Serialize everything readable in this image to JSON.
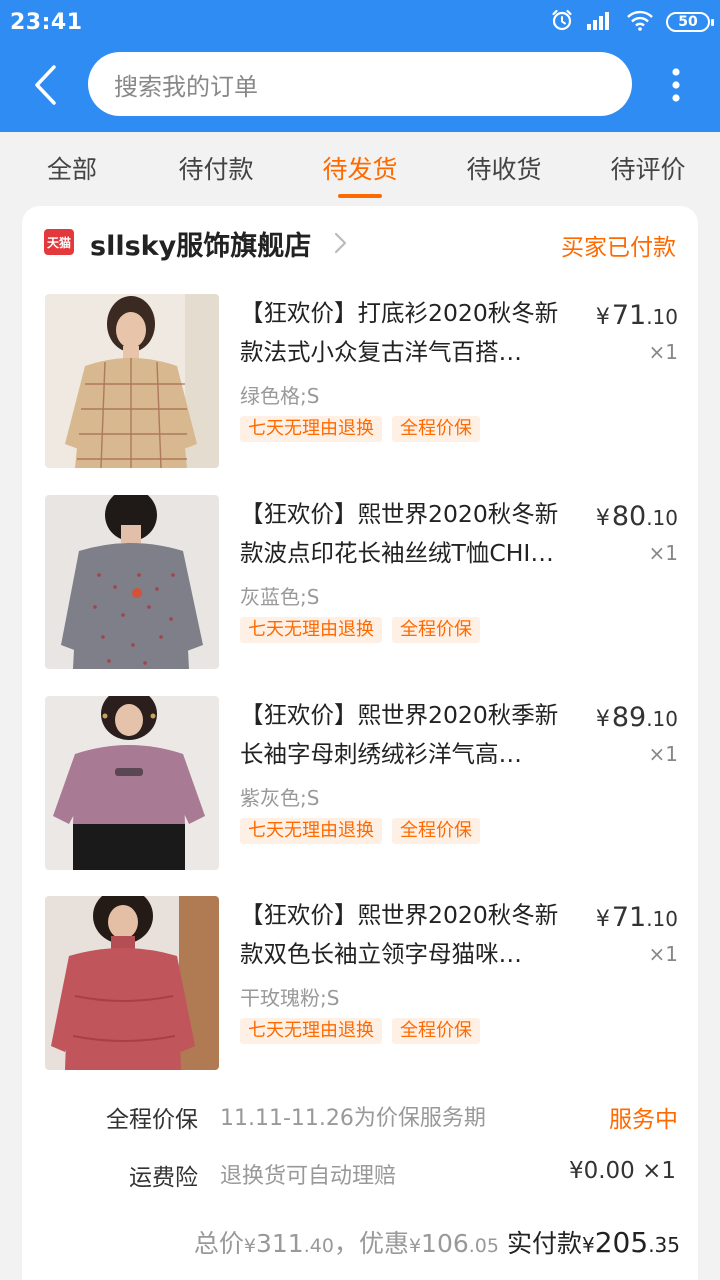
{
  "status_bar": {
    "time": "23:41",
    "battery": "50"
  },
  "search": {
    "placeholder": "搜索我的订单"
  },
  "tabs": [
    {
      "label": "全部",
      "active": false
    },
    {
      "label": "待付款",
      "active": false
    },
    {
      "label": "待发货",
      "active": true
    },
    {
      "label": "待收货",
      "active": false
    },
    {
      "label": "待评价",
      "active": false
    }
  ],
  "shop": {
    "badge": "天猫",
    "name": "sllsky服饰旗舰店",
    "status": "买家已付款"
  },
  "items": [
    {
      "title_line1": "【狂欢价】打底衫2020秋冬新",
      "title_line2": "款法式小众复古洋气百搭…",
      "price_yen": "¥",
      "price_int": "71",
      "price_dec": ".10",
      "qty": "×1",
      "variant": "绿色格;S",
      "tag1": "七天无理由退换",
      "tag2": "全程价保"
    },
    {
      "title_line1": "【狂欢价】熙世界2020秋冬新",
      "title_line2": "款波点印花长袖丝绒T恤CHI…",
      "price_yen": "¥",
      "price_int": "80",
      "price_dec": ".10",
      "qty": "×1",
      "variant": "灰蓝色;S",
      "tag1": "七天无理由退换",
      "tag2": "全程价保"
    },
    {
      "title_line1": "【狂欢价】熙世界2020秋季新",
      "title_line2": "长袖字母刺绣绒衫洋气高…",
      "price_yen": "¥",
      "price_int": "89",
      "price_dec": ".10",
      "qty": "×1",
      "variant": "紫灰色;S",
      "tag1": "七天无理由退换",
      "tag2": "全程价保"
    },
    {
      "title_line1": "【狂欢价】熙世界2020秋冬新",
      "title_line2": "款双色长袖立领字母猫咪…",
      "price_yen": "¥",
      "price_int": "71",
      "price_dec": ".10",
      "qty": "×1",
      "variant": "干玫瑰粉;S",
      "tag1": "七天无理由退换",
      "tag2": "全程价保"
    }
  ],
  "services": {
    "price_protect": {
      "label": "全程价保",
      "desc": "11.11-11.26为价保服务期",
      "status": "服务中"
    },
    "shipping_insurance": {
      "label": "运费险",
      "desc": "退换货可自动理赔",
      "fee": "¥0.00 ×1"
    }
  },
  "totals": {
    "total_label": "总价",
    "total_yen": "¥",
    "total_int": "311",
    "total_dec": ".40",
    "sep": "，",
    "discount_label": "优惠",
    "discount_yen": "¥",
    "discount_int": "106",
    "discount_dec": ".05",
    "paid_label": "实付款",
    "paid_yen": "¥",
    "paid_int": "205",
    "paid_dec": ".35"
  },
  "colors": {
    "header_blue": "#2f8cf3",
    "accent_orange": "#ff6a00",
    "tmall_red": "#e4393c"
  },
  "icons": [
    "back-arrow-icon",
    "more-vertical-icon",
    "alarm-icon",
    "signal-icon",
    "wifi-icon",
    "battery-icon",
    "chevron-right-icon"
  ]
}
